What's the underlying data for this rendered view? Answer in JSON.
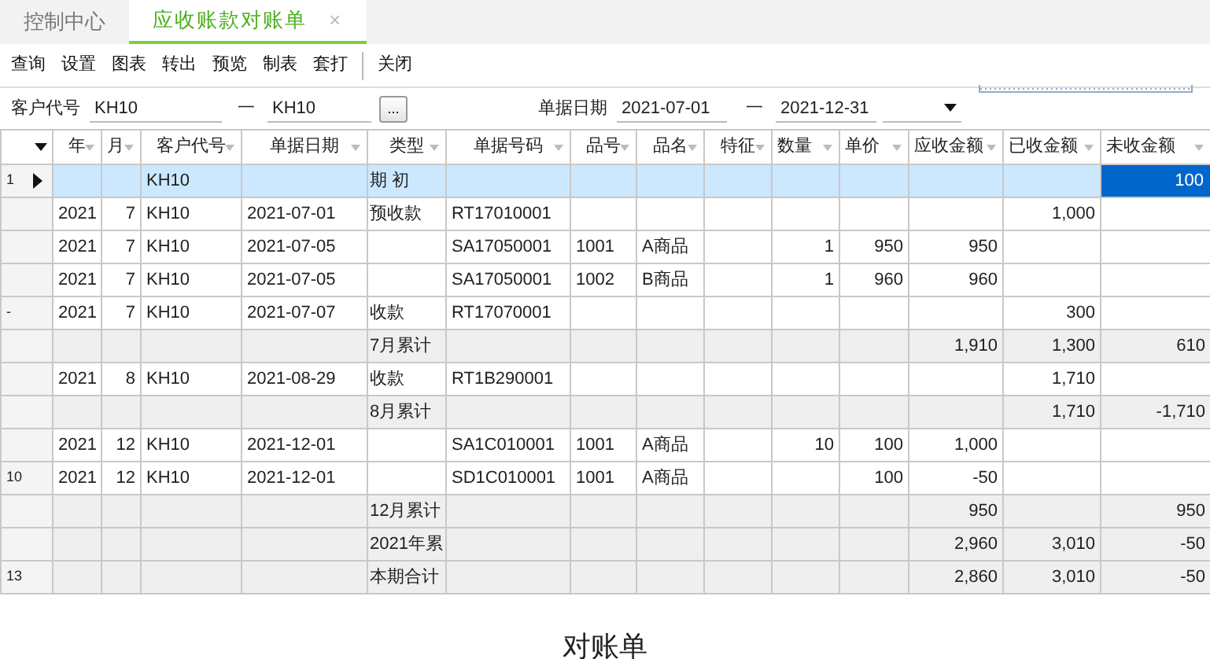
{
  "tabs": [
    {
      "label": "控制中心",
      "selected": false,
      "closable": false
    },
    {
      "label": "应收账款对账单",
      "selected": true,
      "closable": true,
      "close": "×"
    }
  ],
  "toolbar": [
    {
      "label": "查询",
      "group_start": false
    },
    {
      "label": "设置",
      "group_start": false
    },
    {
      "label": "图表",
      "group_start": false
    },
    {
      "label": "转出",
      "group_start": false
    },
    {
      "label": "预览",
      "group_start": false
    },
    {
      "label": "制表",
      "group_start": false
    },
    {
      "label": "套打",
      "group_start": false
    },
    {
      "label": "关闭",
      "group_start": true
    }
  ],
  "filters": {
    "customer": {
      "label": "客户代号",
      "from": "KH10",
      "dash": "一",
      "to": "KH10",
      "browse": "..."
    },
    "date": {
      "label": "单据日期",
      "from": "2021-07-01",
      "dash": "一",
      "to": "2021-12-31"
    }
  },
  "grid": {
    "columns": [
      {
        "label": "年",
        "numeric": false
      },
      {
        "label": "月",
        "numeric": true
      },
      {
        "label": "客户代号",
        "numeric": false
      },
      {
        "label": "单据日期",
        "numeric": false
      },
      {
        "label": "类型",
        "numeric": false
      },
      {
        "label": "单据号码",
        "numeric": false
      },
      {
        "label": "品号",
        "numeric": false
      },
      {
        "label": "品名",
        "numeric": false
      },
      {
        "label": "特征",
        "numeric": false
      },
      {
        "label": "数量",
        "numeric": true
      },
      {
        "label": "单价",
        "numeric": true
      },
      {
        "label": "应收金额",
        "numeric": true
      },
      {
        "label": "已收金额",
        "numeric": true
      },
      {
        "label": "未收金额",
        "numeric": true
      }
    ],
    "rows": [
      {
        "row_label": "1",
        "current": true,
        "selected": true,
        "kind": "detail",
        "cells": [
          null,
          null,
          "KH10",
          null,
          "期 初",
          null,
          null,
          null,
          null,
          null,
          null,
          null,
          null,
          {
            "text": "100",
            "focused": true
          }
        ]
      },
      {
        "current": false,
        "selected": false,
        "kind": "detail",
        "cells": [
          "2021",
          "7",
          "KH10",
          "2021-07-01",
          "预收款",
          "RT17010001",
          null,
          null,
          null,
          null,
          null,
          null,
          "1,000",
          null
        ]
      },
      {
        "current": false,
        "selected": false,
        "kind": "detail",
        "cells": [
          "2021",
          "7",
          "KH10",
          "2021-07-05",
          null,
          "SA17050001",
          "1001",
          "A商品",
          null,
          "1",
          "950",
          "950",
          null,
          null
        ]
      },
      {
        "current": false,
        "selected": false,
        "kind": "detail",
        "cells": [
          "2021",
          "7",
          "KH10",
          "2021-07-05",
          null,
          "SA17050001",
          "1002",
          "B商品",
          null,
          "1",
          "960",
          "960",
          null,
          null
        ]
      },
      {
        "row_label": "-",
        "current": false,
        "selected": false,
        "kind": "detail",
        "cells": [
          "2021",
          "7",
          "KH10",
          "2021-07-07",
          "收款",
          "RT17070001",
          null,
          null,
          null,
          null,
          null,
          null,
          "300",
          null
        ]
      },
      {
        "current": false,
        "selected": false,
        "kind": "subtotal",
        "cells": [
          null,
          null,
          null,
          null,
          "7月累计",
          null,
          null,
          null,
          null,
          null,
          null,
          "1,910",
          "1,300",
          "610"
        ]
      },
      {
        "current": false,
        "selected": false,
        "kind": "detail",
        "cells": [
          "2021",
          "8",
          "KH10",
          "2021-08-29",
          "收款",
          "RT1B290001",
          null,
          null,
          null,
          null,
          null,
          null,
          "1,710",
          null
        ]
      },
      {
        "current": false,
        "selected": false,
        "kind": "subtotal",
        "cells": [
          null,
          null,
          null,
          null,
          "8月累计",
          null,
          null,
          null,
          null,
          null,
          null,
          null,
          "1,710",
          "-1,710"
        ]
      },
      {
        "current": false,
        "selected": false,
        "kind": "detail",
        "cells": [
          "2021",
          "12",
          "KH10",
          "2021-12-01",
          null,
          "SA1C010001",
          "1001",
          "A商品",
          null,
          "10",
          "100",
          "1,000",
          null,
          null
        ]
      },
      {
        "row_label": "10",
        "current": false,
        "selected": false,
        "kind": "detail",
        "cells": [
          "2021",
          "12",
          "KH10",
          "2021-12-01",
          null,
          "SD1C010001",
          "1001",
          "A商品",
          null,
          null,
          "100",
          "-50",
          null,
          null
        ]
      },
      {
        "current": false,
        "selected": false,
        "kind": "subtotal",
        "cells": [
          null,
          null,
          null,
          null,
          "12月累计",
          null,
          null,
          null,
          null,
          null,
          null,
          "950",
          null,
          "950"
        ]
      },
      {
        "current": false,
        "selected": false,
        "kind": "subtotal",
        "cells": [
          null,
          null,
          null,
          null,
          "2021年累",
          null,
          null,
          null,
          null,
          null,
          null,
          "2,960",
          "3,010",
          "-50"
        ]
      },
      {
        "row_label": "13",
        "current": false,
        "selected": false,
        "kind": "subtotal",
        "cells": [
          null,
          null,
          null,
          null,
          "本期合计",
          null,
          null,
          null,
          null,
          null,
          null,
          "2,860",
          "3,010",
          "-50"
        ]
      }
    ]
  },
  "caption": "对账单"
}
